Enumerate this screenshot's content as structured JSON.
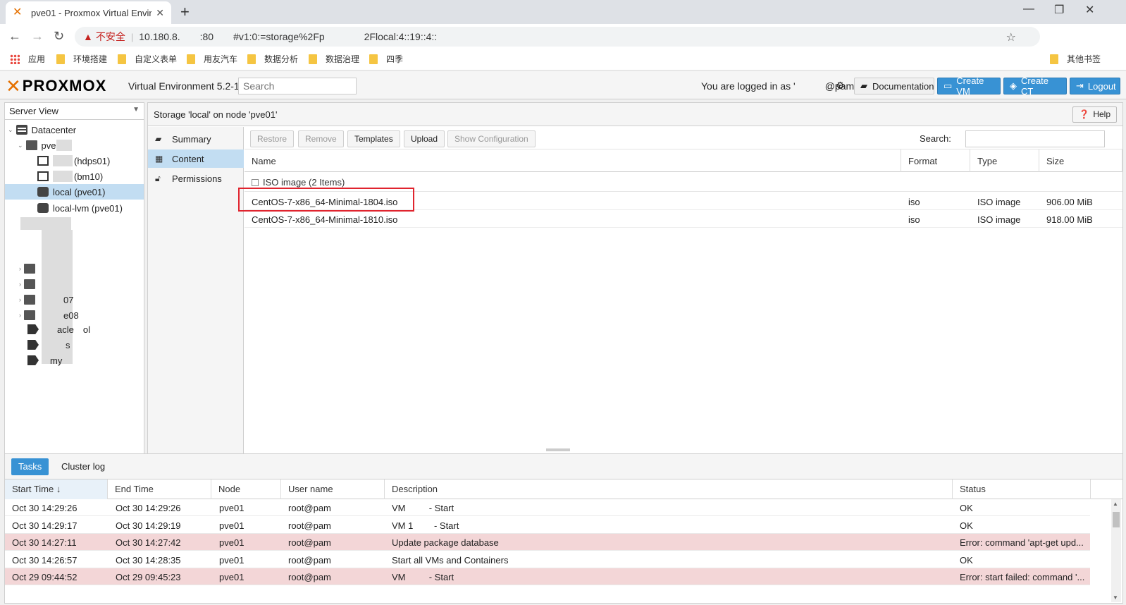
{
  "browser": {
    "tab_title": "pve01 - Proxmox Virtual Enviró",
    "tab_close": "✕",
    "new_tab": "+",
    "min": "—",
    "restore": "❐",
    "close": "✕",
    "back": "←",
    "forward": "→",
    "reload": "↻",
    "insecure_label": "不安全",
    "url": "10.180.8.  :80  #v1:0:=storage%2Fp    2Flocal:4::19::4::",
    "bookmarks": [
      {
        "label": "应用"
      },
      {
        "label": "环境搭建"
      },
      {
        "label": "自定义表单"
      },
      {
        "label": "用友汽车"
      },
      {
        "label": "数据分析"
      },
      {
        "label": "数据治理"
      },
      {
        "label": "四季"
      },
      {
        "label": "其他书签"
      }
    ]
  },
  "header": {
    "logo_text": "PROXMOX",
    "version": "Virtual Environment 5.2-1",
    "search_placeholder": "Search",
    "logged_in": "You are logged in as '   @pam'",
    "documentation": "Documentation",
    "create_vm": "Create VM",
    "create_ct": "Create CT",
    "logout": "Logout"
  },
  "tree": {
    "view": "Server View",
    "datacenter": "Datacenter",
    "node": "pve",
    "vm1": "(hdps01)",
    "vm2": "(bm10)",
    "storage_local": "local (pve01)",
    "storage_lvm": "local-lvm (pve01)",
    "partial1": "07",
    "partial2": "e08",
    "pool1": "acle ol",
    "pool2": "s",
    "pool3": "my"
  },
  "panel": {
    "title": "Storage 'local' on node 'pve01'",
    "help": "Help",
    "menu": [
      {
        "label": "Summary",
        "icon": "book-icon"
      },
      {
        "label": "Content",
        "icon": "grid-icon"
      },
      {
        "label": "Permissions",
        "icon": "unlock-icon"
      }
    ],
    "toolbar": {
      "restore": "Restore",
      "remove": "Remove",
      "templates": "Templates",
      "upload": "Upload",
      "show_config": "Show Configuration",
      "search_label": "Search:"
    },
    "columns": [
      "Name",
      "Format",
      "Type",
      "Size"
    ],
    "group_label": "ISO image (2 Items)",
    "rows": [
      {
        "name": "CentOS-7-x86_64-Minimal-1804.iso",
        "format": "iso",
        "type": "ISO image",
        "size": "906.00 MiB"
      },
      {
        "name": "CentOS-7-x86_64-Minimal-1810.iso",
        "format": "iso",
        "type": "ISO image",
        "size": "918.00 MiB"
      }
    ]
  },
  "tasks": {
    "tab_tasks": "Tasks",
    "tab_cluster": "Cluster log",
    "columns": [
      "Start Time ↓",
      "End Time",
      "Node",
      "User name",
      "Description",
      "Status"
    ],
    "rows": [
      {
        "start": "Oct 30 14:29:26",
        "end": "Oct 30 14:29:26",
        "node": "pve01",
        "user": "root@pam",
        "desc": "VM    - Start",
        "status": "OK",
        "error": false
      },
      {
        "start": "Oct 30 14:29:17",
        "end": "Oct 30 14:29:19",
        "node": "pve01",
        "user": "root@pam",
        "desc": "VM 1   - Start",
        "status": "OK",
        "error": false
      },
      {
        "start": "Oct 30 14:27:11",
        "end": "Oct 30 14:27:42",
        "node": "pve01",
        "user": "root@pam",
        "desc": "Update package database",
        "status": "Error: command 'apt-get upd...",
        "error": true
      },
      {
        "start": "Oct 30 14:26:57",
        "end": "Oct 30 14:28:35",
        "node": "pve01",
        "user": "root@pam",
        "desc": "Start all VMs and Containers",
        "status": "OK",
        "error": false
      },
      {
        "start": "Oct 29 09:44:52",
        "end": "Oct 29 09:45:23",
        "node": "pve01",
        "user": "root@pam",
        "desc": "VM    - Start",
        "status": "Error: start failed: command '...",
        "error": true
      }
    ]
  },
  "colors": {
    "proxmox_orange": "#e57000",
    "button_blue": "#3892d4",
    "selection": "#c2ddf2",
    "error_row": "#f3d6d7",
    "highlight_box": "#e0242e"
  }
}
